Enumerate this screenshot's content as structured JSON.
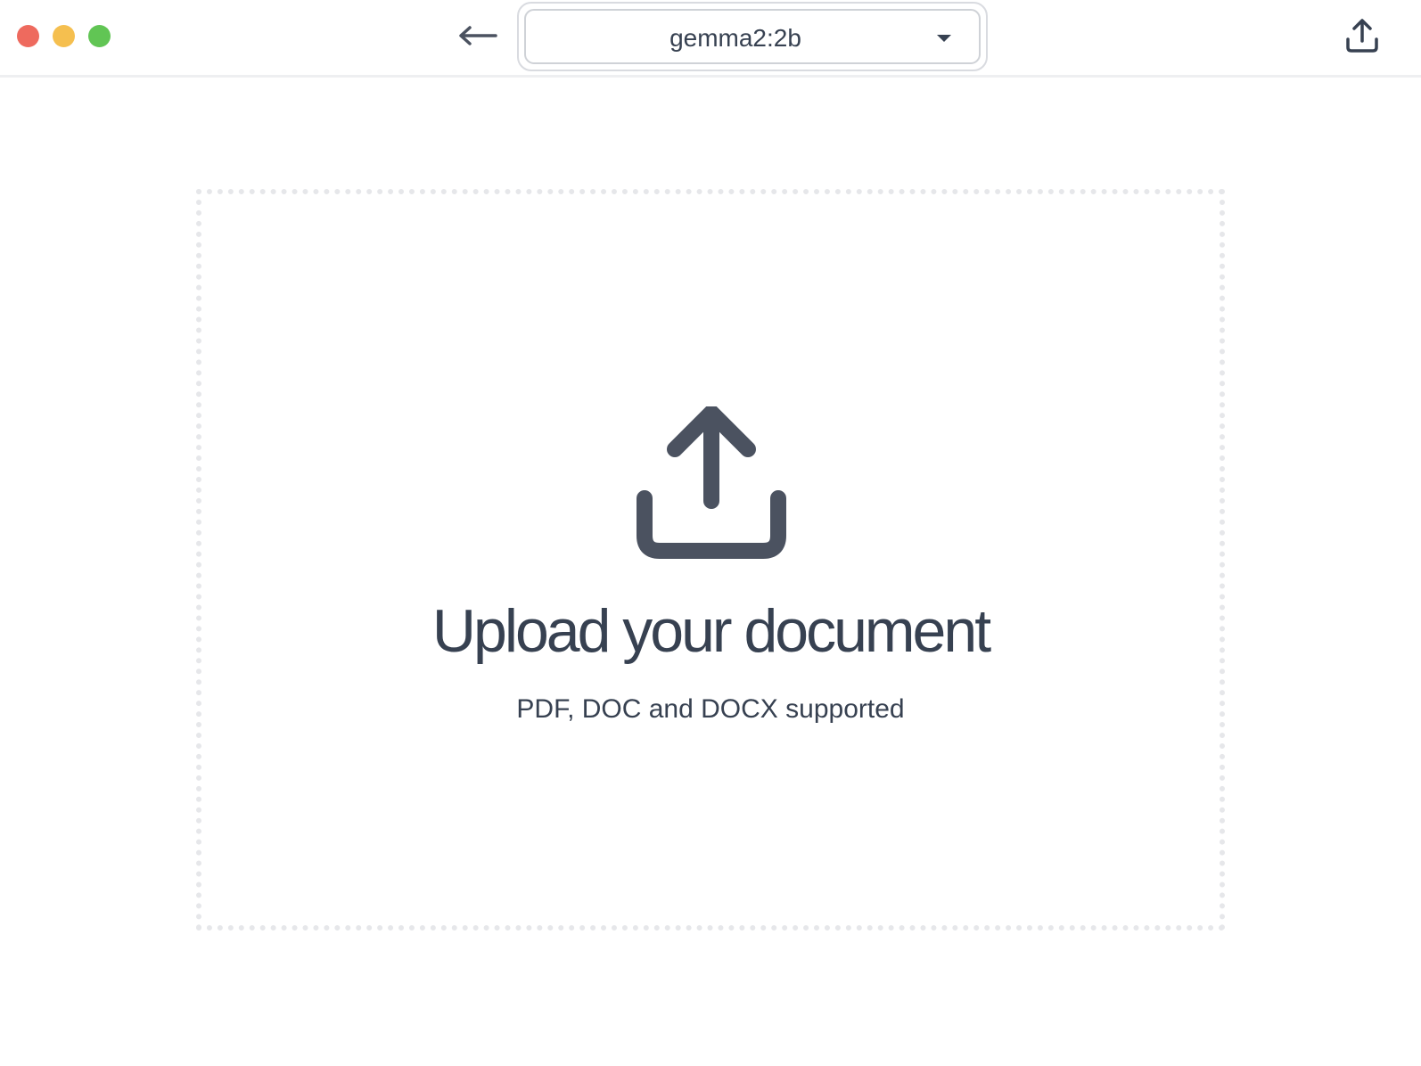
{
  "window": {
    "controls": {
      "close_color": "#ee6a5e",
      "minimize_color": "#f5bf4f",
      "zoom_color": "#61c554"
    }
  },
  "toolbar": {
    "back_icon": "arrow-left-icon",
    "model_select": {
      "value": "gemma2:2b",
      "caret_icon": "caret-down-icon"
    },
    "share_icon": "share-upload-icon"
  },
  "dropzone": {
    "icon": "upload-icon",
    "title": "Upload your document",
    "subtitle": "PDF, DOC and DOCX supported"
  },
  "colors": {
    "text": "#374151",
    "icon": "#4b5260",
    "border_dotted": "#e6e7ea"
  }
}
